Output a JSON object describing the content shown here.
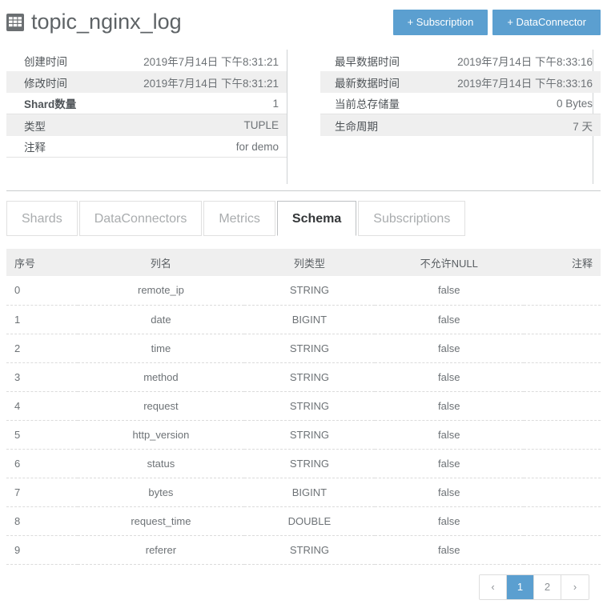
{
  "header": {
    "title": "topic_nginx_log",
    "icon": "table-grid-icon",
    "buttons": [
      {
        "label": "+ Subscription",
        "name": "add-subscription-button"
      },
      {
        "label": "+ DataConnector",
        "name": "add-dataconnector-button"
      }
    ]
  },
  "colors": {
    "accent": "#5b9fd0",
    "header_row_bg": "#efefef",
    "text": "#6d7276"
  },
  "info_left": [
    {
      "key": "创建时间",
      "value": "2019年7月14日 下午8:31:21",
      "bold": false
    },
    {
      "key": "修改时间",
      "value": "2019年7月14日 下午8:31:21",
      "bold": false
    },
    {
      "key": "Shard数量",
      "value": "1",
      "bold": true
    },
    {
      "key": "类型",
      "value": "TUPLE",
      "bold": false
    },
    {
      "key": "注释",
      "value": "for demo",
      "bold": false
    }
  ],
  "info_right": [
    {
      "key": "最早数据时间",
      "value": "2019年7月14日 下午8:33:16",
      "bold": false
    },
    {
      "key": "最新数据时间",
      "value": "2019年7月14日 下午8:33:16",
      "bold": false
    },
    {
      "key": "当前总存储量",
      "value": "0 Bytes",
      "bold": false
    },
    {
      "key": "生命周期",
      "value": "7 天",
      "bold": false
    }
  ],
  "tabs": [
    {
      "label": "Shards",
      "active": false
    },
    {
      "label": "DataConnectors",
      "active": false
    },
    {
      "label": "Metrics",
      "active": false
    },
    {
      "label": "Schema",
      "active": true
    },
    {
      "label": "Subscriptions",
      "active": false
    }
  ],
  "schema_table": {
    "columns": [
      "序号",
      "列名",
      "列类型",
      "不允许NULL",
      "注释"
    ],
    "rows": [
      [
        "0",
        "remote_ip",
        "STRING",
        "false",
        ""
      ],
      [
        "1",
        "date",
        "BIGINT",
        "false",
        ""
      ],
      [
        "2",
        "time",
        "STRING",
        "false",
        ""
      ],
      [
        "3",
        "method",
        "STRING",
        "false",
        ""
      ],
      [
        "4",
        "request",
        "STRING",
        "false",
        ""
      ],
      [
        "5",
        "http_version",
        "STRING",
        "false",
        ""
      ],
      [
        "6",
        "status",
        "STRING",
        "false",
        ""
      ],
      [
        "7",
        "bytes",
        "BIGINT",
        "false",
        ""
      ],
      [
        "8",
        "request_time",
        "DOUBLE",
        "false",
        ""
      ],
      [
        "9",
        "referer",
        "STRING",
        "false",
        ""
      ]
    ]
  },
  "pagination": {
    "prev": "‹",
    "next": "›",
    "pages": [
      "1",
      "2"
    ],
    "current": "1"
  }
}
